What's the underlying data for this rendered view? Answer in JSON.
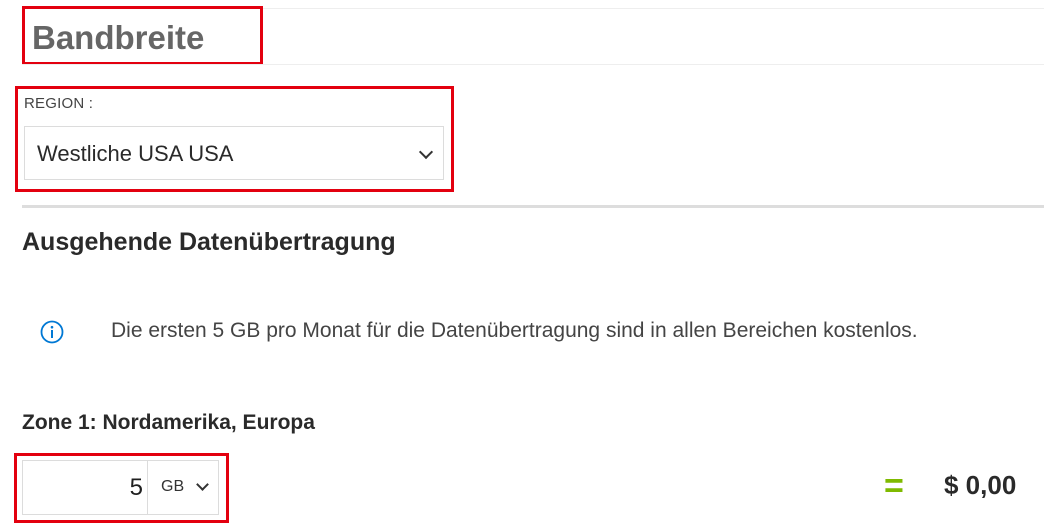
{
  "header": {
    "title": "Bandbreite"
  },
  "region": {
    "label": "REGION :",
    "selected": "Westliche USA USA"
  },
  "outbound": {
    "title": "Ausgehende Datenübertragung",
    "info_icon": "info-icon",
    "info_text": "Die ersten 5 GB pro Monat für die Datenübertragung sind in allen Bereichen kostenlos."
  },
  "zone1": {
    "title": "Zone 1: Nordamerika, Europa",
    "quantity": "5",
    "unit": "GB",
    "equals": "=",
    "price": "$ 0,00"
  },
  "colors": {
    "highlight": "#e3000f",
    "equals_accent": "#7fba00",
    "info_icon": "#0078d4",
    "title_gray": "#666666"
  }
}
